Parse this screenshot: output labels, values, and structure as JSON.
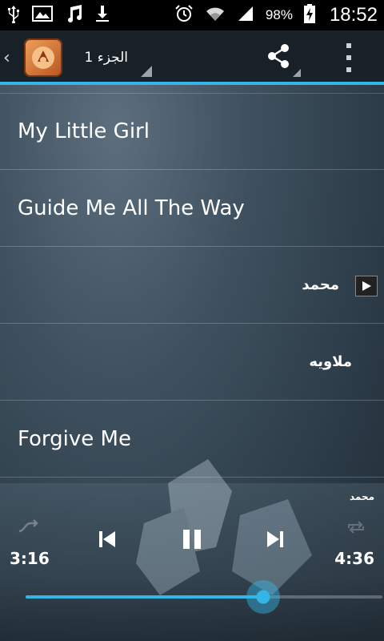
{
  "status_bar": {
    "icons": [
      "usb-icon",
      "image-icon",
      "music-note-icon",
      "download-icon",
      "alarm-icon",
      "wifi-icon",
      "signal-icon",
      "battery-charging-icon"
    ],
    "battery": "98%",
    "time": "18:52"
  },
  "action_bar": {
    "back_icon": "chevron-left-icon",
    "logo_icon": "app-logo-icon",
    "album_title": "الجزء 1",
    "share_icon": "share-icon",
    "overflow_icon": "overflow-menu-icon",
    "accent_color": "#33b5e5"
  },
  "tracks": [
    {
      "title": "My Little Girl",
      "rtl": false,
      "playing": false
    },
    {
      "title": "Guide Me All The Way",
      "rtl": false,
      "playing": false
    },
    {
      "title": "محمد",
      "rtl": true,
      "playing": true
    },
    {
      "title": "ملاويه",
      "rtl": true,
      "playing": false
    },
    {
      "title": "Forgive Me",
      "rtl": false,
      "playing": false
    }
  ],
  "player": {
    "now_playing": "محمد",
    "elapsed": "3:16",
    "total": "4:36",
    "progress": 0.665,
    "shuffle_icon": "shuffle-icon",
    "prev_icon": "skip-previous-icon",
    "pause_icon": "pause-icon",
    "next_icon": "skip-next-icon",
    "repeat_icon": "repeat-icon"
  }
}
